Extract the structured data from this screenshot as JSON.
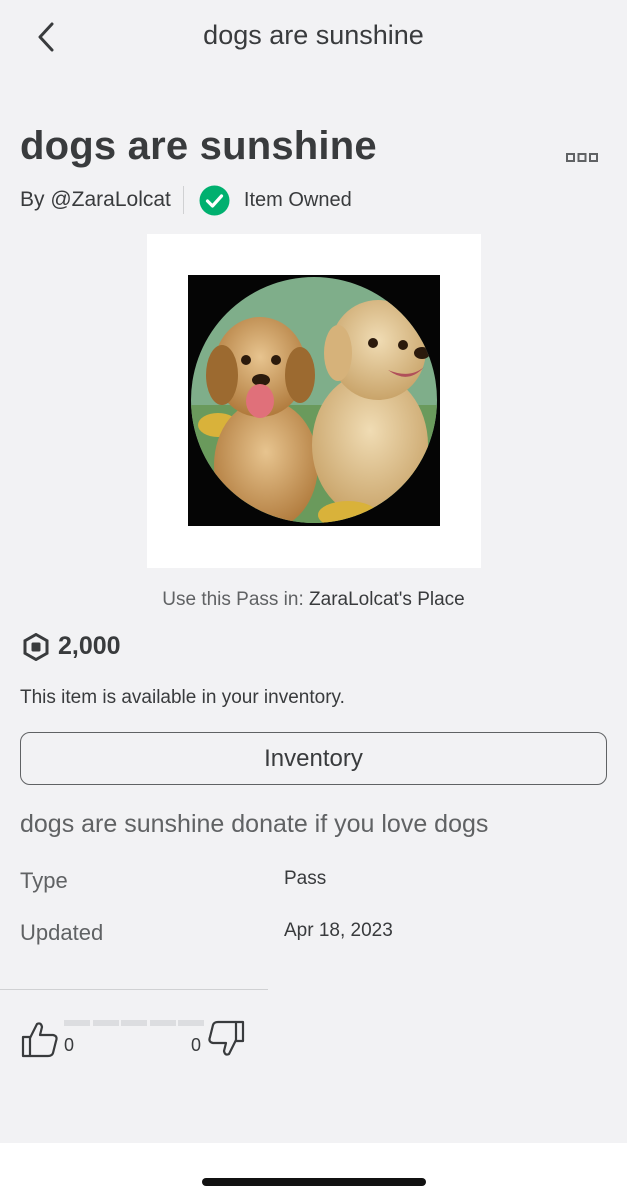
{
  "nav": {
    "title": "dogs are sunshine",
    "back_icon": "chevron-left-icon"
  },
  "item": {
    "title": "dogs are sunshine",
    "by_prefix": "By",
    "creator": "@ZaraLolcat",
    "owned_label": "Item Owned",
    "more_icon": "more-options-icon"
  },
  "thumbnail": {
    "alt": "two golden retriever puppies"
  },
  "use_pass": {
    "prefix": "Use this Pass in:",
    "place": "ZaraLolcat's Place"
  },
  "price": {
    "icon": "robux-icon",
    "value": "2,000"
  },
  "availability": "This item is available in your inventory.",
  "inventory_button": "Inventory",
  "description": "dogs are sunshine donate if you love dogs",
  "details": {
    "type_label": "Type",
    "type_value": "Pass",
    "updated_label": "Updated",
    "updated_value": "Apr 18, 2023"
  },
  "votes": {
    "upvotes": "0",
    "downvotes": "0",
    "upvote_icon": "thumbs-up-icon",
    "downvote_icon": "thumbs-down-icon"
  },
  "colors": {
    "background": "#f2f2f4",
    "text_primary": "#393b3d",
    "text_secondary": "#606264",
    "owned_green": "#00b06f",
    "card": "#ffffff"
  }
}
